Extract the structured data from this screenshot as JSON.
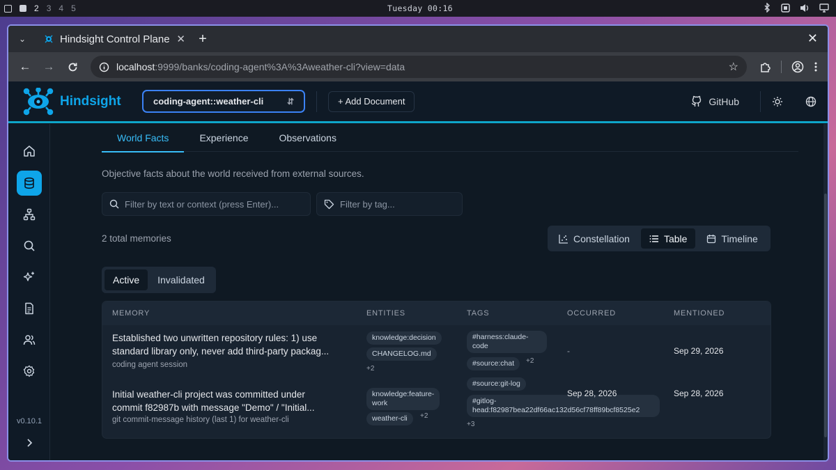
{
  "desktop": {
    "workspaces": [
      "2",
      "3",
      "4",
      "5"
    ],
    "clock": "Tuesday 00:16"
  },
  "browser": {
    "tab_title": "Hindsight Control Plane",
    "url_host": "localhost",
    "url_path": ":9999/banks/coding-agent%3A%3Aweather-cli?view=data"
  },
  "app": {
    "logo_text": "Hindsight",
    "bank_selector": "coding-agent::weather-cli",
    "add_document": "+ Add Document",
    "github": "GitHub",
    "version": "v0.10.1",
    "accent": "#0ea5e9"
  },
  "tabs": [
    "World Facts",
    "Experience",
    "Observations"
  ],
  "description": "Objective facts about the world received from external sources.",
  "filters": {
    "text_placeholder": "Filter by text or context (press Enter)...",
    "tag_placeholder": "Filter by tag..."
  },
  "total": "2 total memories",
  "views": [
    "Constellation",
    "Table",
    "Timeline"
  ],
  "status_toggle": [
    "Active",
    "Invalidated"
  ],
  "table": {
    "headers": [
      "MEMORY",
      "ENTITIES",
      "TAGS",
      "OCCURRED",
      "MENTIONED"
    ],
    "rows": [
      {
        "memory_line1": "Established two unwritten repository rules: 1) use",
        "memory_line2": "standard library only, never add third-party packag...",
        "context": "coding agent session",
        "entity1": "knowledge:decision",
        "entity2": "CHANGELOG.md",
        "entity_more": "+2",
        "tag1_line1": "#harness:claude-",
        "tag1_line2": "code",
        "tag2": "#source:chat",
        "tag_more": "+2",
        "occurred": "-",
        "mentioned": "Sep 29, 2026"
      },
      {
        "memory_line1": "Initial weather-cli project was committed under",
        "memory_line2": "commit f82987b with message \"Demo\" / \"Initial...",
        "context": "git commit-message history (last 1) for weather-cli",
        "entity1_line1": "knowledge:feature-",
        "entity1_line2": "work",
        "entity2": "weather-cli",
        "entity_more": "+2",
        "tag1": "#source:git-log",
        "tag2_line1": "#gitlog-",
        "tag2_line2": "head:f82987bea22df66ac132d56cf78ff89bcf8525e2",
        "tag_more": "+3",
        "occurred": "Sep 28, 2026",
        "mentioned": "Sep 28, 2026"
      }
    ]
  }
}
